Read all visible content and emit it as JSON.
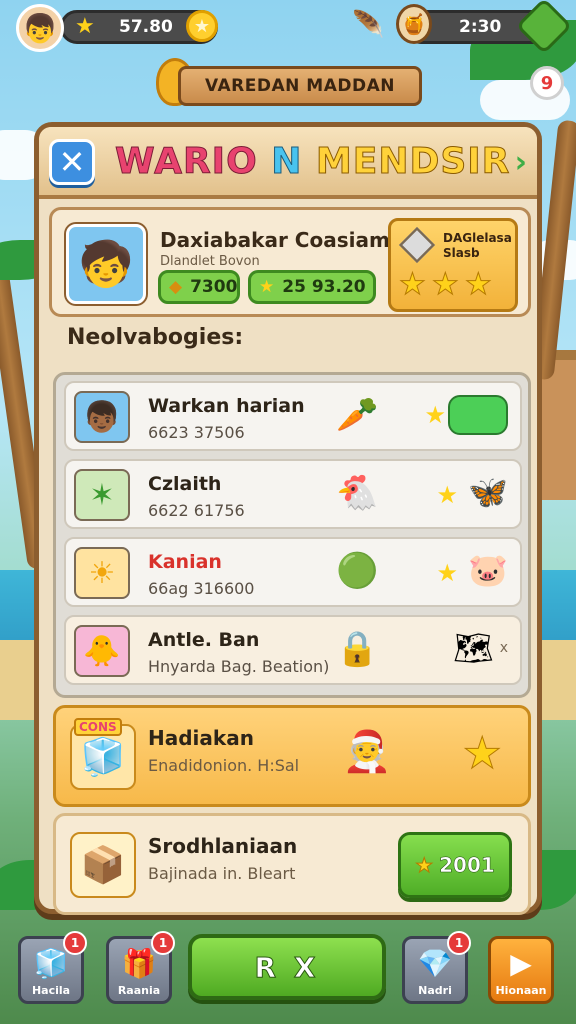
{
  "hud": {
    "coins": "57.80",
    "timer": "2:30"
  },
  "title_banner": "VAREDAN MADDAN",
  "notification": {
    "count": "9"
  },
  "panel": {
    "title_part1": "WARIO",
    "title_part2": "N",
    "title_part3": "MENDSIR",
    "close_label": "✕",
    "next_label": "›"
  },
  "profile": {
    "name": "Daxiabakar Coasiam",
    "subtitle": "Dlandlet Bovon",
    "resource_1": "7300",
    "resource_2": "25 93.20",
    "gold_card_label_line1": "DAGlelasa",
    "gold_card_label_line2": "Slasb"
  },
  "section_label": "Neolvabogies:",
  "rows": [
    {
      "name": "Warkan harian",
      "sub": "6623 37506",
      "name_color": "#2d2418"
    },
    {
      "name": "Czlaith",
      "sub": "6622 61756",
      "name_color": "#2d2418"
    },
    {
      "name": "Kanian",
      "sub": "66ag 316600",
      "name_color": "#d9322b"
    },
    {
      "name": "Antle. Ban",
      "sub": "Hnyarda Bag. Beation)",
      "name_color": "#2d2418",
      "end_label": "x"
    }
  ],
  "features": [
    {
      "name": "Hadiakan",
      "sub": "Enadidonion. H:Sal",
      "badge": "CONS"
    },
    {
      "name": "Srodhlaniaan",
      "sub": "Bajinada in. Bleart",
      "button_label": "2001"
    }
  ],
  "bottom_bar": {
    "btn1": {
      "label": "Hacila",
      "badge": "1"
    },
    "btn2": {
      "label": "Raania",
      "badge": "1"
    },
    "center_label": "R X",
    "btn4": {
      "label": "Nadri",
      "badge": "1"
    },
    "btn5": {
      "label": "Hionaan"
    }
  }
}
